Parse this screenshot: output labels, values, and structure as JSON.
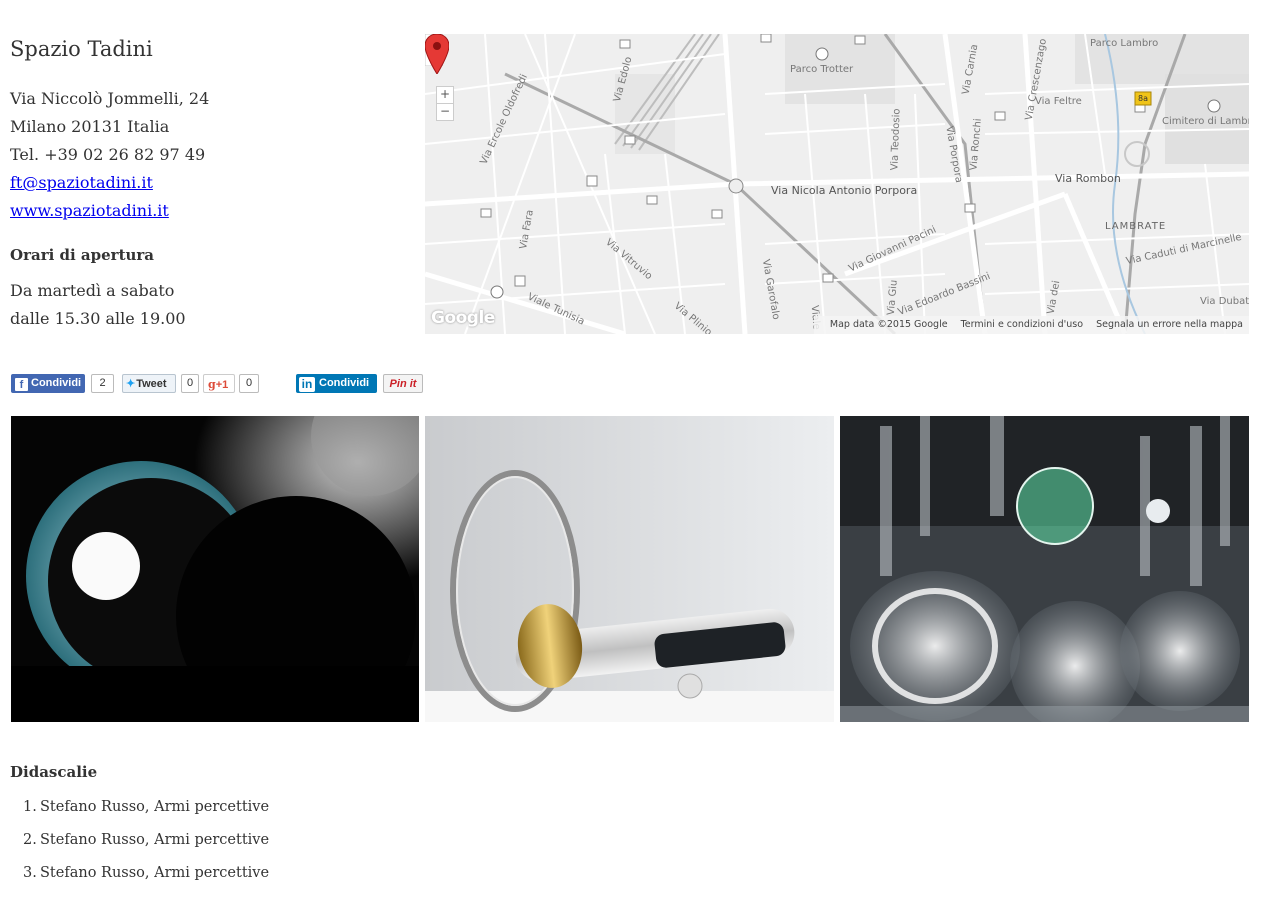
{
  "venue": {
    "name": "Spazio Tadini",
    "address_line1": "Via Niccolò Jommelli, 24",
    "address_line2": "Milano 20131 Italia",
    "phone": "Tel. +39 02 26 82 97 49",
    "email": "ft@spaziotadini.it",
    "website": "www.spaziotadini.it"
  },
  "hours": {
    "heading": "Orari di apertura",
    "line1": "Da martedì a sabato",
    "line2": "dalle 15.30 alle 19.00"
  },
  "map": {
    "labels": {
      "parco_trotter": "Parco Trotter",
      "parco_lambro": "Parco Lambro",
      "via_porpora": "Via Nicola Antonio Porpora",
      "via_rombon": "Via Rombon",
      "lambrate": "LAMBRATE",
      "cimitero": "Cimitero di Lambr",
      "via_edolo": "Via Edolo",
      "via_oldofredi": "Via Ercole Oldofredi",
      "via_vitruvio": "Via Vitruvio",
      "via_plinio": "Via Plinio",
      "viale_tunisia": "Viale Tunisia",
      "via_garofalo": "Via Garofalo",
      "via_pacini": "Via Giovanni Pacini",
      "via_bassini": "Via Edoardo Bassini",
      "via_feltre": "Via Feltre",
      "via_crescenzago": "Via Crescenzago",
      "via_teodosio": "Via Teodosio",
      "via_pezzotti": "Via Porpora",
      "via_ronchi": "Via Ronchi",
      "via_carnia": "Via Carnia",
      "via_fara": "Via Fara",
      "via_caduti": "Via Caduti di Marcinelle",
      "via_dubai": "Via Dubat",
      "via_dei": "Via dei",
      "via_giu": "Via Giu",
      "viale": "Viale",
      "route_badge": "8a",
      "google": "Google"
    },
    "zoom_in": "+",
    "zoom_out": "−",
    "footer": {
      "data": "Map data ©2015 Google",
      "terms": "Termini e condizioni d'uso",
      "report": "Segnala un errore nella mappa"
    }
  },
  "share": {
    "facebook_label": "Condividi",
    "facebook_count": "2",
    "twitter_label": "Tweet",
    "twitter_count": "0",
    "gplus_label": "+1",
    "gplus_count": "0",
    "linkedin_label": "Condividi",
    "linkedin_icon": "in",
    "pinterest_label": "Pin it"
  },
  "captions": {
    "heading": "Didascalie",
    "items": [
      {
        "num": "1.",
        "text": "Stefano Russo, Armi percettive"
      },
      {
        "num": "2.",
        "text": "Stefano Russo, Armi percettive"
      },
      {
        "num": "3.",
        "text": "Stefano Russo, Armi percettive"
      }
    ]
  },
  "colors": {
    "link": "#0000ee",
    "facebook": "#4267b2",
    "linkedin": "#0077b5",
    "pinterest": "#cb2027",
    "map_pin": "#e53935"
  }
}
